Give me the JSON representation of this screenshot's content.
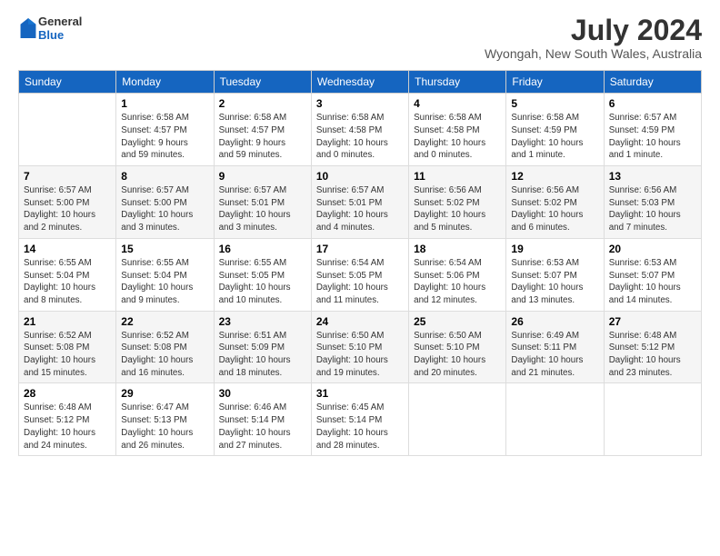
{
  "header": {
    "logo_general": "General",
    "logo_blue": "Blue",
    "month_year": "July 2024",
    "location": "Wyongah, New South Wales, Australia"
  },
  "weekdays": [
    "Sunday",
    "Monday",
    "Tuesday",
    "Wednesday",
    "Thursday",
    "Friday",
    "Saturday"
  ],
  "weeks": [
    [
      {
        "day": "",
        "info": ""
      },
      {
        "day": "1",
        "info": "Sunrise: 6:58 AM\nSunset: 4:57 PM\nDaylight: 9 hours\nand 59 minutes."
      },
      {
        "day": "2",
        "info": "Sunrise: 6:58 AM\nSunset: 4:57 PM\nDaylight: 9 hours\nand 59 minutes."
      },
      {
        "day": "3",
        "info": "Sunrise: 6:58 AM\nSunset: 4:58 PM\nDaylight: 10 hours\nand 0 minutes."
      },
      {
        "day": "4",
        "info": "Sunrise: 6:58 AM\nSunset: 4:58 PM\nDaylight: 10 hours\nand 0 minutes."
      },
      {
        "day": "5",
        "info": "Sunrise: 6:58 AM\nSunset: 4:59 PM\nDaylight: 10 hours\nand 1 minute."
      },
      {
        "day": "6",
        "info": "Sunrise: 6:57 AM\nSunset: 4:59 PM\nDaylight: 10 hours\nand 1 minute."
      }
    ],
    [
      {
        "day": "7",
        "info": "Sunrise: 6:57 AM\nSunset: 5:00 PM\nDaylight: 10 hours\nand 2 minutes."
      },
      {
        "day": "8",
        "info": "Sunrise: 6:57 AM\nSunset: 5:00 PM\nDaylight: 10 hours\nand 3 minutes."
      },
      {
        "day": "9",
        "info": "Sunrise: 6:57 AM\nSunset: 5:01 PM\nDaylight: 10 hours\nand 3 minutes."
      },
      {
        "day": "10",
        "info": "Sunrise: 6:57 AM\nSunset: 5:01 PM\nDaylight: 10 hours\nand 4 minutes."
      },
      {
        "day": "11",
        "info": "Sunrise: 6:56 AM\nSunset: 5:02 PM\nDaylight: 10 hours\nand 5 minutes."
      },
      {
        "day": "12",
        "info": "Sunrise: 6:56 AM\nSunset: 5:02 PM\nDaylight: 10 hours\nand 6 minutes."
      },
      {
        "day": "13",
        "info": "Sunrise: 6:56 AM\nSunset: 5:03 PM\nDaylight: 10 hours\nand 7 minutes."
      }
    ],
    [
      {
        "day": "14",
        "info": "Sunrise: 6:55 AM\nSunset: 5:04 PM\nDaylight: 10 hours\nand 8 minutes."
      },
      {
        "day": "15",
        "info": "Sunrise: 6:55 AM\nSunset: 5:04 PM\nDaylight: 10 hours\nand 9 minutes."
      },
      {
        "day": "16",
        "info": "Sunrise: 6:55 AM\nSunset: 5:05 PM\nDaylight: 10 hours\nand 10 minutes."
      },
      {
        "day": "17",
        "info": "Sunrise: 6:54 AM\nSunset: 5:05 PM\nDaylight: 10 hours\nand 11 minutes."
      },
      {
        "day": "18",
        "info": "Sunrise: 6:54 AM\nSunset: 5:06 PM\nDaylight: 10 hours\nand 12 minutes."
      },
      {
        "day": "19",
        "info": "Sunrise: 6:53 AM\nSunset: 5:07 PM\nDaylight: 10 hours\nand 13 minutes."
      },
      {
        "day": "20",
        "info": "Sunrise: 6:53 AM\nSunset: 5:07 PM\nDaylight: 10 hours\nand 14 minutes."
      }
    ],
    [
      {
        "day": "21",
        "info": "Sunrise: 6:52 AM\nSunset: 5:08 PM\nDaylight: 10 hours\nand 15 minutes."
      },
      {
        "day": "22",
        "info": "Sunrise: 6:52 AM\nSunset: 5:08 PM\nDaylight: 10 hours\nand 16 minutes."
      },
      {
        "day": "23",
        "info": "Sunrise: 6:51 AM\nSunset: 5:09 PM\nDaylight: 10 hours\nand 18 minutes."
      },
      {
        "day": "24",
        "info": "Sunrise: 6:50 AM\nSunset: 5:10 PM\nDaylight: 10 hours\nand 19 minutes."
      },
      {
        "day": "25",
        "info": "Sunrise: 6:50 AM\nSunset: 5:10 PM\nDaylight: 10 hours\nand 20 minutes."
      },
      {
        "day": "26",
        "info": "Sunrise: 6:49 AM\nSunset: 5:11 PM\nDaylight: 10 hours\nand 21 minutes."
      },
      {
        "day": "27",
        "info": "Sunrise: 6:48 AM\nSunset: 5:12 PM\nDaylight: 10 hours\nand 23 minutes."
      }
    ],
    [
      {
        "day": "28",
        "info": "Sunrise: 6:48 AM\nSunset: 5:12 PM\nDaylight: 10 hours\nand 24 minutes."
      },
      {
        "day": "29",
        "info": "Sunrise: 6:47 AM\nSunset: 5:13 PM\nDaylight: 10 hours\nand 26 minutes."
      },
      {
        "day": "30",
        "info": "Sunrise: 6:46 AM\nSunset: 5:14 PM\nDaylight: 10 hours\nand 27 minutes."
      },
      {
        "day": "31",
        "info": "Sunrise: 6:45 AM\nSunset: 5:14 PM\nDaylight: 10 hours\nand 28 minutes."
      },
      {
        "day": "",
        "info": ""
      },
      {
        "day": "",
        "info": ""
      },
      {
        "day": "",
        "info": ""
      }
    ]
  ]
}
